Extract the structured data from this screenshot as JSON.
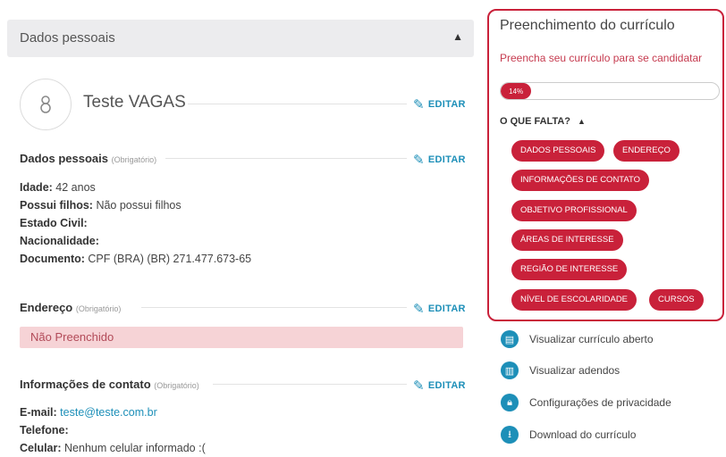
{
  "personal_section": {
    "title": "Dados pessoais"
  },
  "profile": {
    "name": "Teste VAGAS",
    "edit_label": "EDITAR"
  },
  "dados_pessoais": {
    "title": "Dados pessoais",
    "required": "(Obrigatório)",
    "edit_label": "EDITAR",
    "fields": [
      {
        "label": "Idade:",
        "value": "42 anos"
      },
      {
        "label": "Possui filhos:",
        "value": "Não possui filhos"
      },
      {
        "label": "Estado Civil:",
        "value": ""
      },
      {
        "label": "Nacionalidade:",
        "value": ""
      },
      {
        "label": "Documento:",
        "value": "CPF (BRA) (BR) 271.477.673-65"
      }
    ]
  },
  "endereco": {
    "title": "Endereço",
    "required": "(Obrigatório)",
    "edit_label": "EDITAR",
    "empty": "Não Preenchido"
  },
  "contato": {
    "title": "Informações de contato",
    "required": "(Obrigatório)",
    "edit_label": "EDITAR",
    "email_label": "E-mail:",
    "email": "teste@teste.com.br",
    "phone_label": "Telefone:",
    "phone": "",
    "cell_label": "Celular:",
    "cell": "Nenhum celular informado :("
  },
  "completion": {
    "title": "Preenchimento do currículo",
    "subtitle": "Preencha seu currículo para se candidatar",
    "progress_percent": 14,
    "progress_label": "14%",
    "missing_title": "O QUE FALTA?",
    "tags": [
      "DADOS PESSOAIS",
      "ENDEREÇO",
      "INFORMAÇÕES DE CONTATO",
      "OBJETIVO PROFISSIONAL",
      "ÁREAS DE INTERESSE",
      "REGIÃO DE INTERESSE",
      "NÍVEL DE ESCOLARIDADE",
      "CURSOS"
    ],
    "accent": "#c9213a"
  },
  "actions": [
    {
      "label": "Visualizar currículo aberto",
      "icon": "document-icon"
    },
    {
      "label": "Visualizar adendos",
      "icon": "attachment-icon"
    },
    {
      "label": "Configurações de privacidade",
      "icon": "lock-icon"
    },
    {
      "label": "Download do currículo",
      "icon": "download-icon"
    }
  ]
}
